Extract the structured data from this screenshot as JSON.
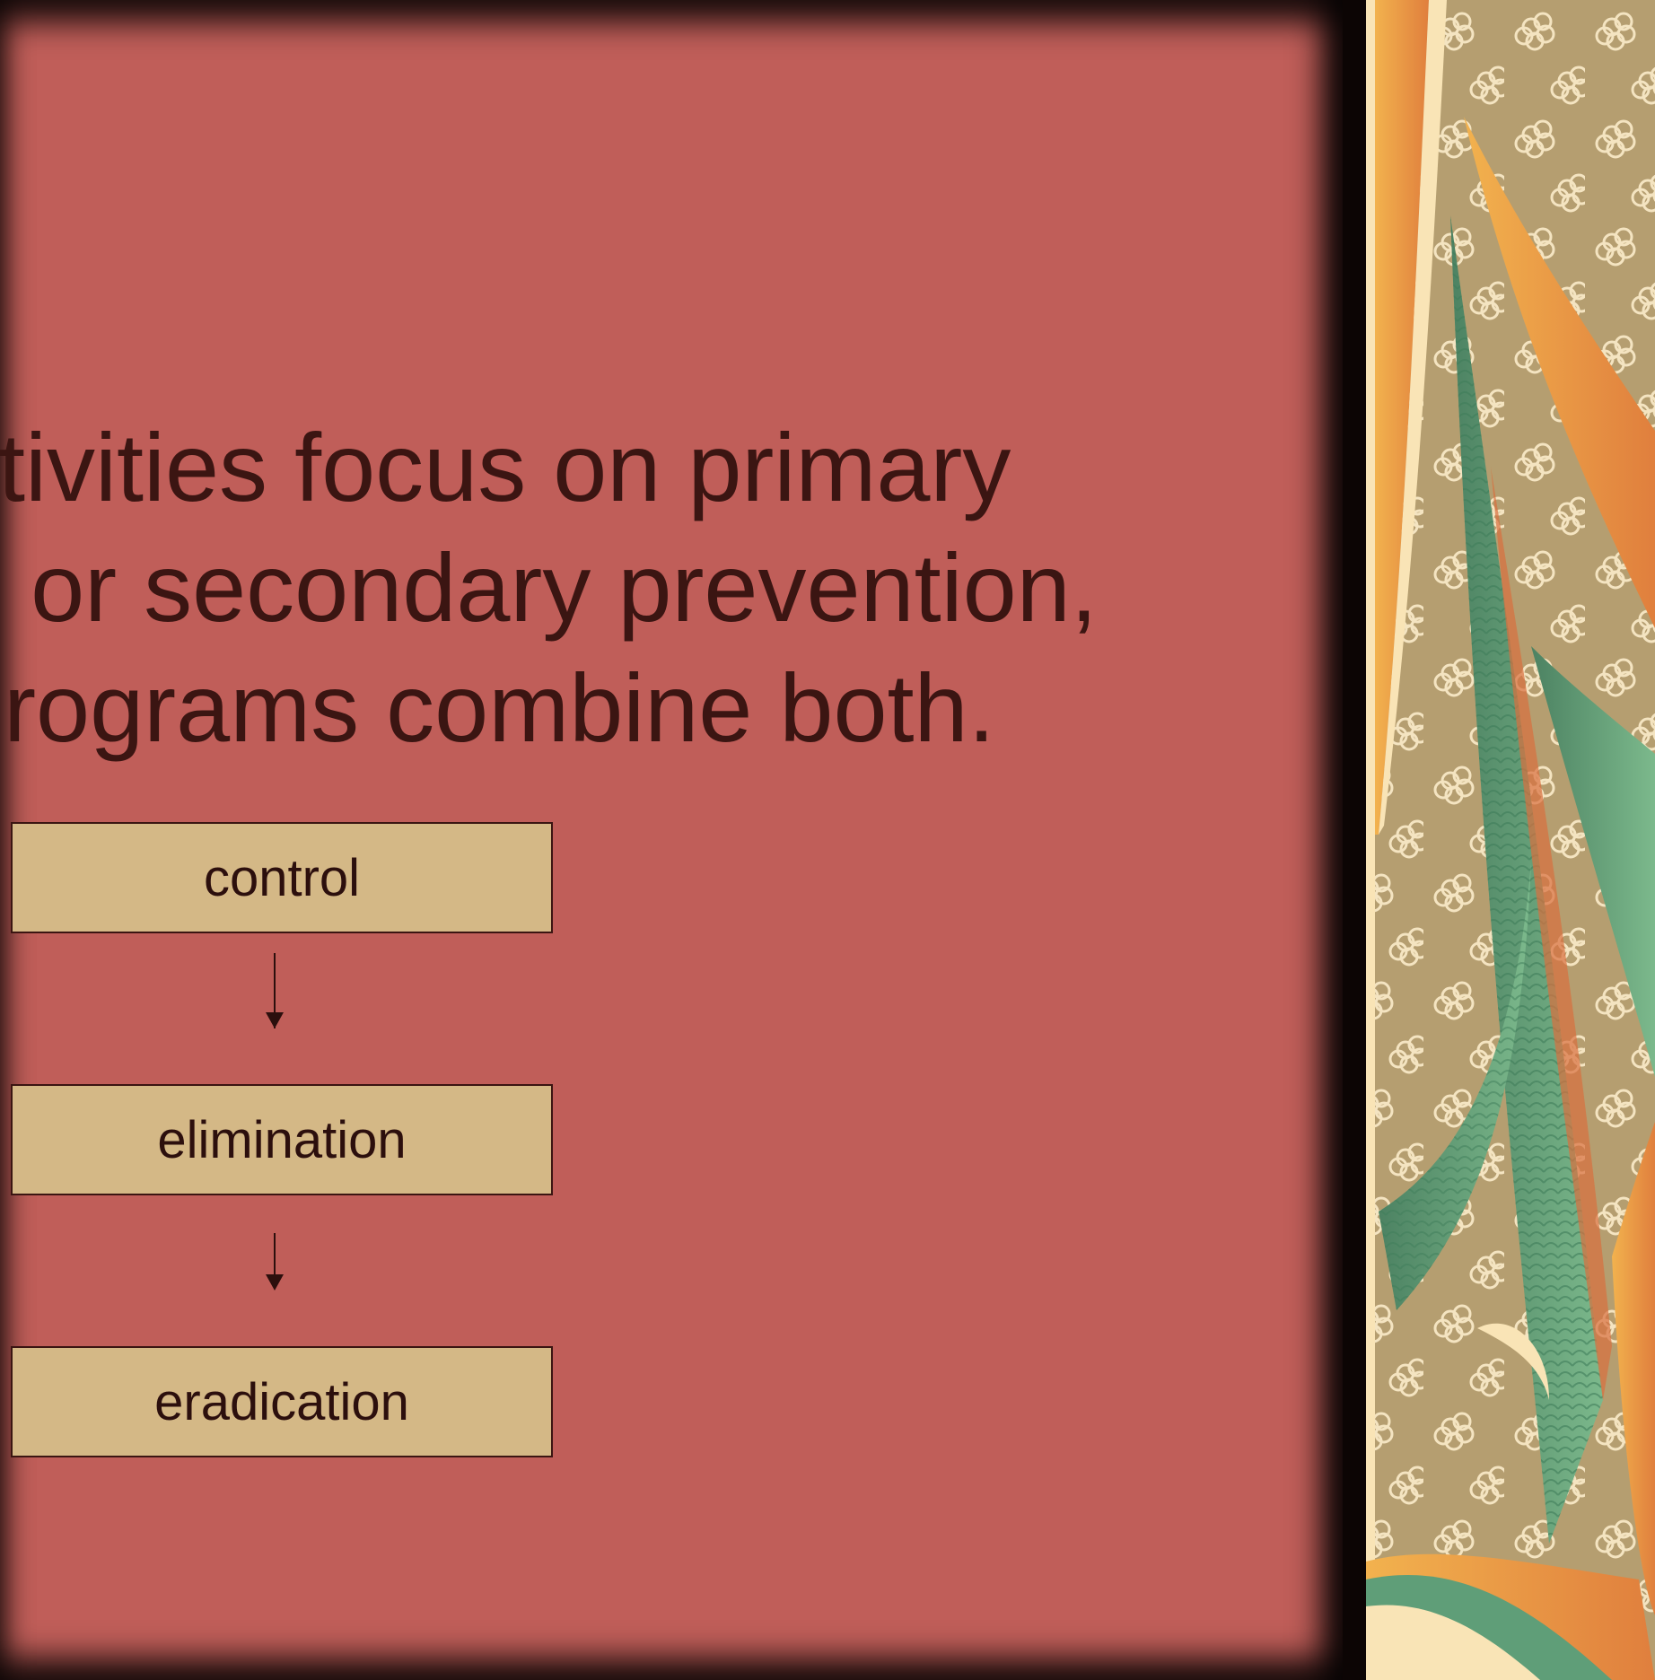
{
  "slide": {
    "body_lines": [
      "ctivities focus on primary",
      "n or secondary prevention,",
      "programs combine both."
    ],
    "flow": [
      {
        "label": "control"
      },
      {
        "label": "elimination"
      },
      {
        "label": "eradication"
      }
    ]
  },
  "colors": {
    "panel": "#c05e59",
    "text": "#3b1512",
    "box": "#d4b886",
    "decor_background": "#b59e70",
    "decor_orange": "#e58a45",
    "decor_green": "#5f9e78",
    "decor_cream": "#f9e4b6"
  },
  "decor": {
    "icon": "flower-pattern-icon"
  }
}
